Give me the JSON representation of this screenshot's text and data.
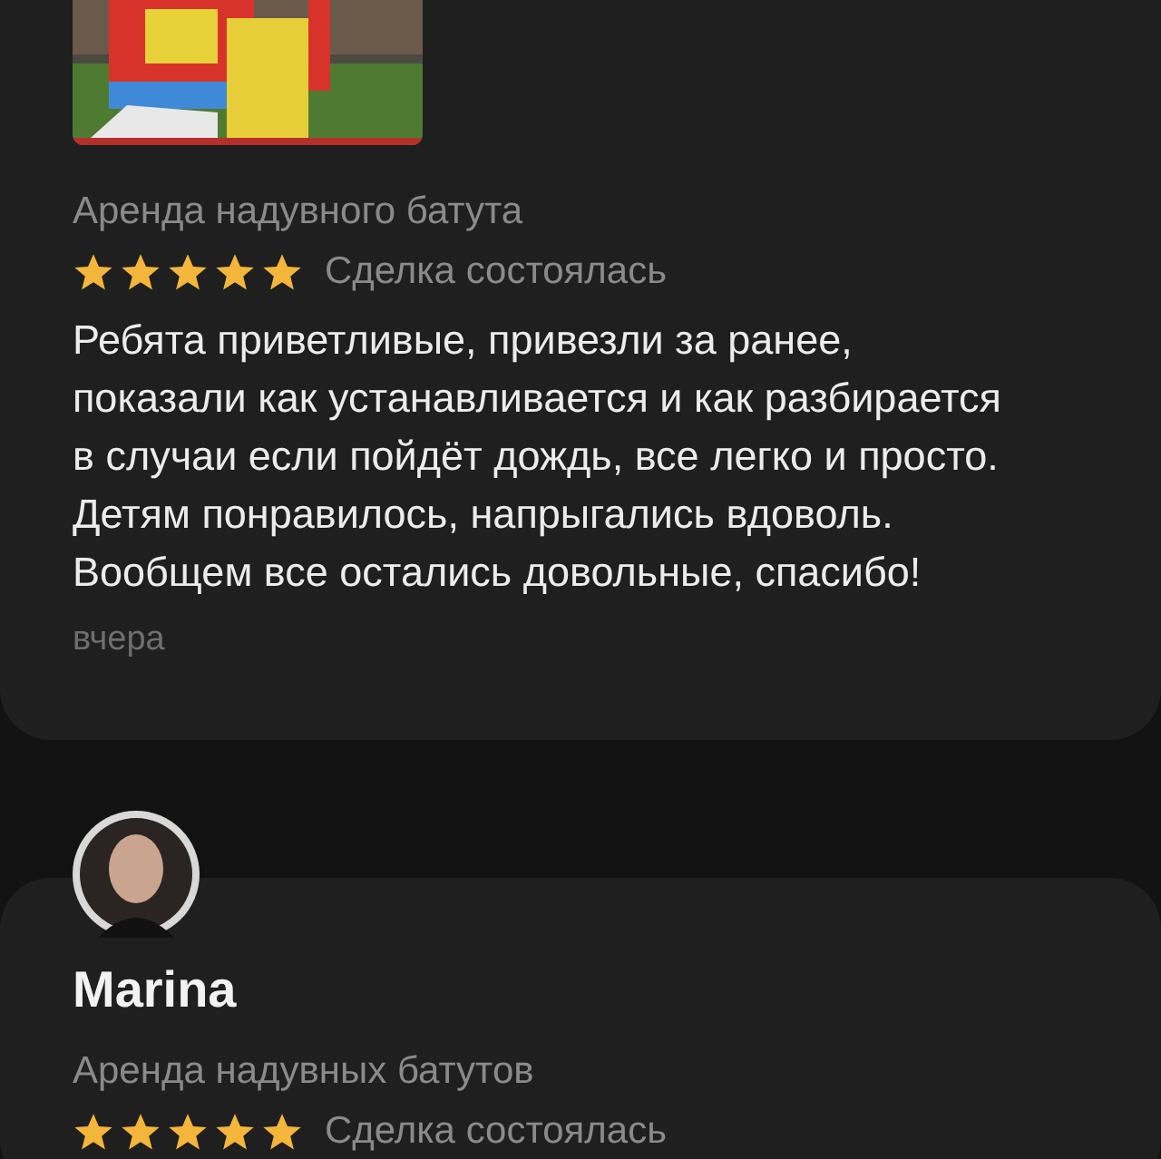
{
  "reviews": [
    {
      "service": "Аренда надувного батута",
      "stars": 5,
      "status": "Сделка состоялась",
      "text": "Ребята приветливые, привезли за ранее,\nпоказали как устанавливается и как разбирается\nв случаи если пойдёт дождь, все легко и просто.\nДетям понравилось, напрыгались вдоволь.\nВообщем все остались довольные, спасибо!",
      "date": "вчера"
    },
    {
      "author": "Marina",
      "service": "Аренда надувных батутов",
      "stars": 5,
      "status": "Сделка состоялась"
    }
  ]
}
